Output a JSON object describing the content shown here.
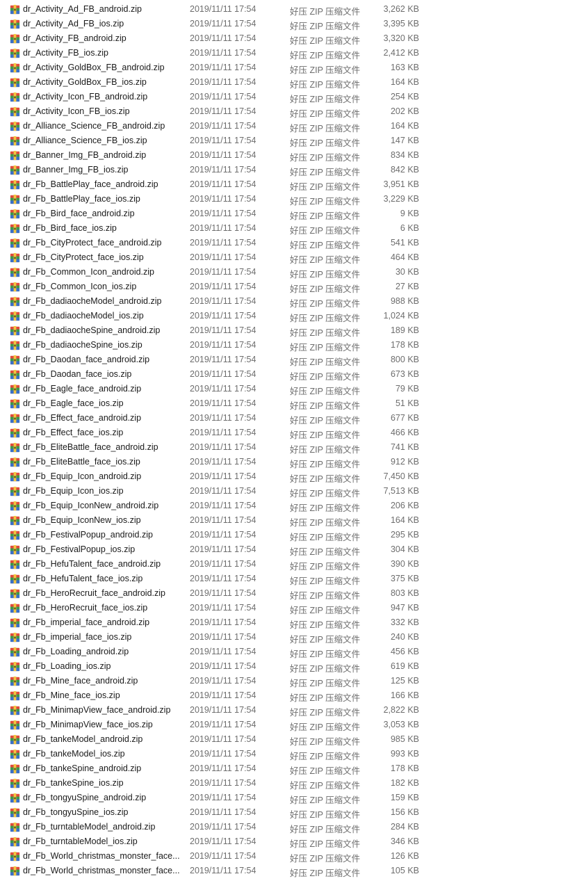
{
  "file_type": "好压 ZIP 压缩文件",
  "icon": "zip-archive-icon",
  "files": [
    {
      "name": "dr_Activity_Ad_FB_android.zip",
      "modified": "2019/11/11 17:54",
      "size": "3,262 KB"
    },
    {
      "name": "dr_Activity_Ad_FB_ios.zip",
      "modified": "2019/11/11 17:54",
      "size": "3,395 KB"
    },
    {
      "name": "dr_Activity_FB_android.zip",
      "modified": "2019/11/11 17:54",
      "size": "3,320 KB"
    },
    {
      "name": "dr_Activity_FB_ios.zip",
      "modified": "2019/11/11 17:54",
      "size": "2,412 KB"
    },
    {
      "name": "dr_Activity_GoldBox_FB_android.zip",
      "modified": "2019/11/11 17:54",
      "size": "163 KB"
    },
    {
      "name": "dr_Activity_GoldBox_FB_ios.zip",
      "modified": "2019/11/11 17:54",
      "size": "164 KB"
    },
    {
      "name": "dr_Activity_Icon_FB_android.zip",
      "modified": "2019/11/11 17:54",
      "size": "254 KB"
    },
    {
      "name": "dr_Activity_Icon_FB_ios.zip",
      "modified": "2019/11/11 17:54",
      "size": "202 KB"
    },
    {
      "name": "dr_Alliance_Science_FB_android.zip",
      "modified": "2019/11/11 17:54",
      "size": "164 KB"
    },
    {
      "name": "dr_Alliance_Science_FB_ios.zip",
      "modified": "2019/11/11 17:54",
      "size": "147 KB"
    },
    {
      "name": "dr_Banner_Img_FB_android.zip",
      "modified": "2019/11/11 17:54",
      "size": "834 KB"
    },
    {
      "name": "dr_Banner_Img_FB_ios.zip",
      "modified": "2019/11/11 17:54",
      "size": "842 KB"
    },
    {
      "name": "dr_Fb_BattlePlay_face_android.zip",
      "modified": "2019/11/11 17:54",
      "size": "3,951 KB"
    },
    {
      "name": "dr_Fb_BattlePlay_face_ios.zip",
      "modified": "2019/11/11 17:54",
      "size": "3,229 KB"
    },
    {
      "name": "dr_Fb_Bird_face_android.zip",
      "modified": "2019/11/11 17:54",
      "size": "9 KB"
    },
    {
      "name": "dr_Fb_Bird_face_ios.zip",
      "modified": "2019/11/11 17:54",
      "size": "6 KB"
    },
    {
      "name": "dr_Fb_CityProtect_face_android.zip",
      "modified": "2019/11/11 17:54",
      "size": "541 KB"
    },
    {
      "name": "dr_Fb_CityProtect_face_ios.zip",
      "modified": "2019/11/11 17:54",
      "size": "464 KB"
    },
    {
      "name": "dr_Fb_Common_Icon_android.zip",
      "modified": "2019/11/11 17:54",
      "size": "30 KB"
    },
    {
      "name": "dr_Fb_Common_Icon_ios.zip",
      "modified": "2019/11/11 17:54",
      "size": "27 KB"
    },
    {
      "name": "dr_Fb_dadiaocheModel_android.zip",
      "modified": "2019/11/11 17:54",
      "size": "988 KB"
    },
    {
      "name": "dr_Fb_dadiaocheModel_ios.zip",
      "modified": "2019/11/11 17:54",
      "size": "1,024 KB"
    },
    {
      "name": "dr_Fb_dadiaocheSpine_android.zip",
      "modified": "2019/11/11 17:54",
      "size": "189 KB"
    },
    {
      "name": "dr_Fb_dadiaocheSpine_ios.zip",
      "modified": "2019/11/11 17:54",
      "size": "178 KB"
    },
    {
      "name": "dr_Fb_Daodan_face_android.zip",
      "modified": "2019/11/11 17:54",
      "size": "800 KB"
    },
    {
      "name": "dr_Fb_Daodan_face_ios.zip",
      "modified": "2019/11/11 17:54",
      "size": "673 KB"
    },
    {
      "name": "dr_Fb_Eagle_face_android.zip",
      "modified": "2019/11/11 17:54",
      "size": "79 KB"
    },
    {
      "name": "dr_Fb_Eagle_face_ios.zip",
      "modified": "2019/11/11 17:54",
      "size": "51 KB"
    },
    {
      "name": "dr_Fb_Effect_face_android.zip",
      "modified": "2019/11/11 17:54",
      "size": "677 KB"
    },
    {
      "name": "dr_Fb_Effect_face_ios.zip",
      "modified": "2019/11/11 17:54",
      "size": "466 KB"
    },
    {
      "name": "dr_Fb_EliteBattle_face_android.zip",
      "modified": "2019/11/11 17:54",
      "size": "741 KB"
    },
    {
      "name": "dr_Fb_EliteBattle_face_ios.zip",
      "modified": "2019/11/11 17:54",
      "size": "912 KB"
    },
    {
      "name": "dr_Fb_Equip_Icon_android.zip",
      "modified": "2019/11/11 17:54",
      "size": "7,450 KB"
    },
    {
      "name": "dr_Fb_Equip_Icon_ios.zip",
      "modified": "2019/11/11 17:54",
      "size": "7,513 KB"
    },
    {
      "name": "dr_Fb_Equip_IconNew_android.zip",
      "modified": "2019/11/11 17:54",
      "size": "206 KB"
    },
    {
      "name": "dr_Fb_Equip_IconNew_ios.zip",
      "modified": "2019/11/11 17:54",
      "size": "164 KB"
    },
    {
      "name": "dr_Fb_FestivalPopup_android.zip",
      "modified": "2019/11/11 17:54",
      "size": "295 KB"
    },
    {
      "name": "dr_Fb_FestivalPopup_ios.zip",
      "modified": "2019/11/11 17:54",
      "size": "304 KB"
    },
    {
      "name": "dr_Fb_HefuTalent_face_android.zip",
      "modified": "2019/11/11 17:54",
      "size": "390 KB"
    },
    {
      "name": "dr_Fb_HefuTalent_face_ios.zip",
      "modified": "2019/11/11 17:54",
      "size": "375 KB"
    },
    {
      "name": "dr_Fb_HeroRecruit_face_android.zip",
      "modified": "2019/11/11 17:54",
      "size": "803 KB"
    },
    {
      "name": "dr_Fb_HeroRecruit_face_ios.zip",
      "modified": "2019/11/11 17:54",
      "size": "947 KB"
    },
    {
      "name": "dr_Fb_imperial_face_android.zip",
      "modified": "2019/11/11 17:54",
      "size": "332 KB"
    },
    {
      "name": "dr_Fb_imperial_face_ios.zip",
      "modified": "2019/11/11 17:54",
      "size": "240 KB"
    },
    {
      "name": "dr_Fb_Loading_android.zip",
      "modified": "2019/11/11 17:54",
      "size": "456 KB"
    },
    {
      "name": "dr_Fb_Loading_ios.zip",
      "modified": "2019/11/11 17:54",
      "size": "619 KB"
    },
    {
      "name": "dr_Fb_Mine_face_android.zip",
      "modified": "2019/11/11 17:54",
      "size": "125 KB"
    },
    {
      "name": "dr_Fb_Mine_face_ios.zip",
      "modified": "2019/11/11 17:54",
      "size": "166 KB"
    },
    {
      "name": "dr_Fb_MinimapView_face_android.zip",
      "modified": "2019/11/11 17:54",
      "size": "2,822 KB"
    },
    {
      "name": "dr_Fb_MinimapView_face_ios.zip",
      "modified": "2019/11/11 17:54",
      "size": "3,053 KB"
    },
    {
      "name": "dr_Fb_tankeModel_android.zip",
      "modified": "2019/11/11 17:54",
      "size": "985 KB"
    },
    {
      "name": "dr_Fb_tankeModel_ios.zip",
      "modified": "2019/11/11 17:54",
      "size": "993 KB"
    },
    {
      "name": "dr_Fb_tankeSpine_android.zip",
      "modified": "2019/11/11 17:54",
      "size": "178 KB"
    },
    {
      "name": "dr_Fb_tankeSpine_ios.zip",
      "modified": "2019/11/11 17:54",
      "size": "182 KB"
    },
    {
      "name": "dr_Fb_tongyuSpine_android.zip",
      "modified": "2019/11/11 17:54",
      "size": "159 KB"
    },
    {
      "name": "dr_Fb_tongyuSpine_ios.zip",
      "modified": "2019/11/11 17:54",
      "size": "156 KB"
    },
    {
      "name": "dr_Fb_turntableModel_android.zip",
      "modified": "2019/11/11 17:54",
      "size": "284 KB"
    },
    {
      "name": "dr_Fb_turntableModel_ios.zip",
      "modified": "2019/11/11 17:54",
      "size": "346 KB"
    },
    {
      "name": "dr_Fb_World_christmas_monster_face...",
      "modified": "2019/11/11 17:54",
      "size": "126 KB"
    },
    {
      "name": "dr_Fb_World_christmas_monster_face...",
      "modified": "2019/11/11 17:54",
      "size": "105 KB"
    }
  ]
}
